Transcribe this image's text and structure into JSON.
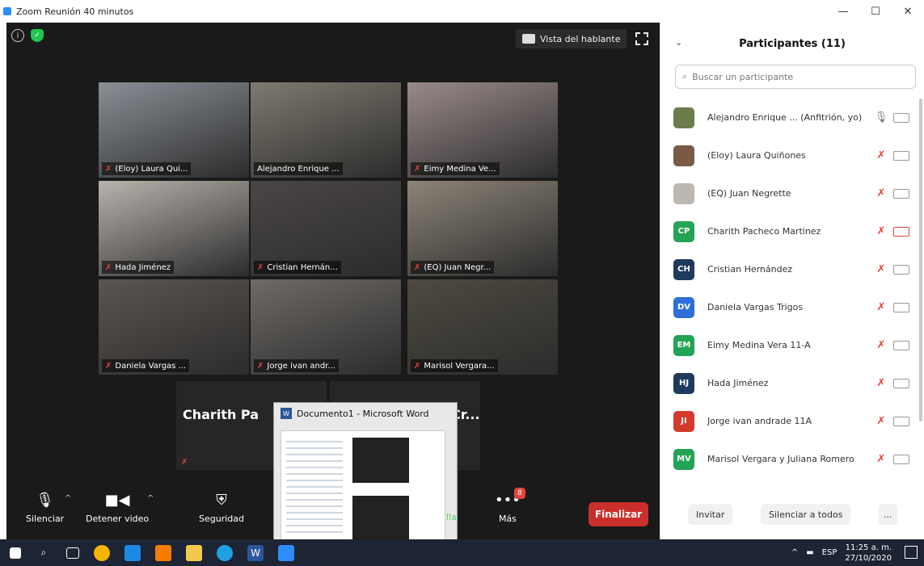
{
  "window": {
    "title": "Zoom Reunión 40 minutos",
    "minimize": "—",
    "maximize": "☐",
    "close": "✕"
  },
  "meeting": {
    "view_label": "Vista del hablante",
    "tiles": [
      {
        "name": "(Eloy) Laura Qui...",
        "muted": true,
        "scene": "#8a8f96"
      },
      {
        "name": "Alejandro Enrique ...",
        "muted": false,
        "scene": "#7f7a70"
      },
      {
        "name": "Eimy Medina Ve...",
        "muted": true,
        "scene": "#9a8a8a"
      },
      {
        "name": "Hada Jiménez",
        "muted": true,
        "scene": "#b9b3ad"
      },
      {
        "name": "Cristian Hernán...",
        "muted": true,
        "scene": "#4a4645"
      },
      {
        "name": "(EQ) Juan Negr...",
        "muted": true,
        "scene": "#8c8478"
      },
      {
        "name": "Daniela Vargas ...",
        "muted": true,
        "scene": "#5b5550"
      },
      {
        "name": "Jorge ivan andr...",
        "muted": true,
        "scene": "#6e6a66"
      },
      {
        "name": "Marisol Vergara...",
        "muted": true,
        "scene": "#4e4a40"
      }
    ],
    "bottom_tiles": [
      {
        "name": "Charith Pa"
      },
      {
        "name": "Cr..."
      }
    ],
    "popup": {
      "title": "Documento1 - Microsoft Word"
    },
    "controls": {
      "mute": "Silenciar",
      "video": "Detener video",
      "security": "Seguridad",
      "share_fragment": "lla",
      "more": "Más",
      "more_badge": "8",
      "end": "Finalizar"
    }
  },
  "participants": {
    "title": "Participantes (11)",
    "search_placeholder": "Buscar un participante",
    "list": [
      {
        "name": "Alejandro Enrique ...  (Anfitrión, yo)",
        "initials": "",
        "color": "#6b7d4c",
        "mic_on": true,
        "cam_on": true
      },
      {
        "name": "(Eloy) Laura Quiñones",
        "initials": "",
        "color": "#7a5a45",
        "mic_on": false,
        "cam_on": true
      },
      {
        "name": "(EQ) Juan Negrette",
        "initials": "",
        "color": "#bcb8b0",
        "mic_on": false,
        "cam_on": true
      },
      {
        "name": "Charith Pacheco Martinez",
        "initials": "CP",
        "color": "#23a455",
        "mic_on": false,
        "cam_on": false
      },
      {
        "name": "Cristian Hernández",
        "initials": "CH",
        "color": "#1f3a5f",
        "mic_on": false,
        "cam_on": true
      },
      {
        "name": "Daniela Vargas Trigos",
        "initials": "DV",
        "color": "#2d6fd6",
        "mic_on": false,
        "cam_on": true
      },
      {
        "name": "Eimy Medina Vera 11-A",
        "initials": "EM",
        "color": "#23a455",
        "mic_on": false,
        "cam_on": true
      },
      {
        "name": "Hada Jiménez",
        "initials": "HJ",
        "color": "#1f3a5f",
        "mic_on": false,
        "cam_on": true
      },
      {
        "name": "Jorge ivan andrade 11A",
        "initials": "JI",
        "color": "#d33a2c",
        "mic_on": false,
        "cam_on": true
      },
      {
        "name": "Marisol Vergara y Juliana Romero",
        "initials": "MV",
        "color": "#23a455",
        "mic_on": false,
        "cam_on": true
      }
    ],
    "invite": "Invitar",
    "mute_all": "Silenciar a todos",
    "more": "..."
  },
  "taskbar": {
    "lang": "ESP",
    "time": "11:25 a. m.",
    "date": "27/10/2020"
  }
}
